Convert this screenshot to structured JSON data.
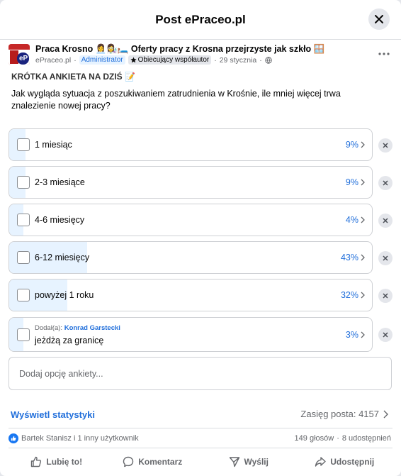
{
  "modal": {
    "title": "Post ePraceo.pl"
  },
  "post": {
    "page_name": "Praca Krosno 👩‍💼👩‍🔬🛏️ Oferty pracy z Krosna przejrzyste jak szkło 🪟",
    "author": "ePraceo.pl",
    "admin_badge": "Administrator",
    "contributor_badge": "Obiecujący współautor",
    "date": "29 stycznia",
    "avatar_text": "eP",
    "heading": "KRÓTKA ANKIETA NA DZIŚ 📝",
    "text": "Jak wygląda sytuacja z poszukiwaniem zatrudnienia w Krośnie, ile mniej więcej trwa znalezienie nowej pracy?"
  },
  "poll": {
    "options": [
      {
        "label": "1 miesiąc",
        "percent_label": "9%",
        "percent": 9
      },
      {
        "label": "2-3 miesiące",
        "percent_label": "9%",
        "percent": 9
      },
      {
        "label": "4-6 miesięcy",
        "percent_label": "4%",
        "percent": 4
      },
      {
        "label": "6-12 miesięcy",
        "percent_label": "43%",
        "percent": 43
      },
      {
        "label": "powyżej 1 roku",
        "percent_label": "32%",
        "percent": 32
      },
      {
        "label": "jeżdżą za granicę",
        "percent_label": "3%",
        "percent": 3,
        "added_by_prefix": "Dodał(a):",
        "added_by_name": "Konrad Garstecki"
      }
    ],
    "add_placeholder": "Dodaj opcję ankiety..."
  },
  "stats": {
    "link": "Wyświetl statystyki",
    "reach": "Zasięg posta: 4157"
  },
  "engagement": {
    "reactions": "Bartek Stanisz i 1 inny użytkownik",
    "votes": "149 głosów",
    "shares": "8 udostępnień"
  },
  "actions": {
    "like": "Lubię to!",
    "comment": "Komentarz",
    "send": "Wyślij",
    "share": "Udostępnij"
  },
  "colors": {
    "accent": "#216fdb",
    "fill": "#e7f3ff",
    "like": "#1877f2"
  }
}
